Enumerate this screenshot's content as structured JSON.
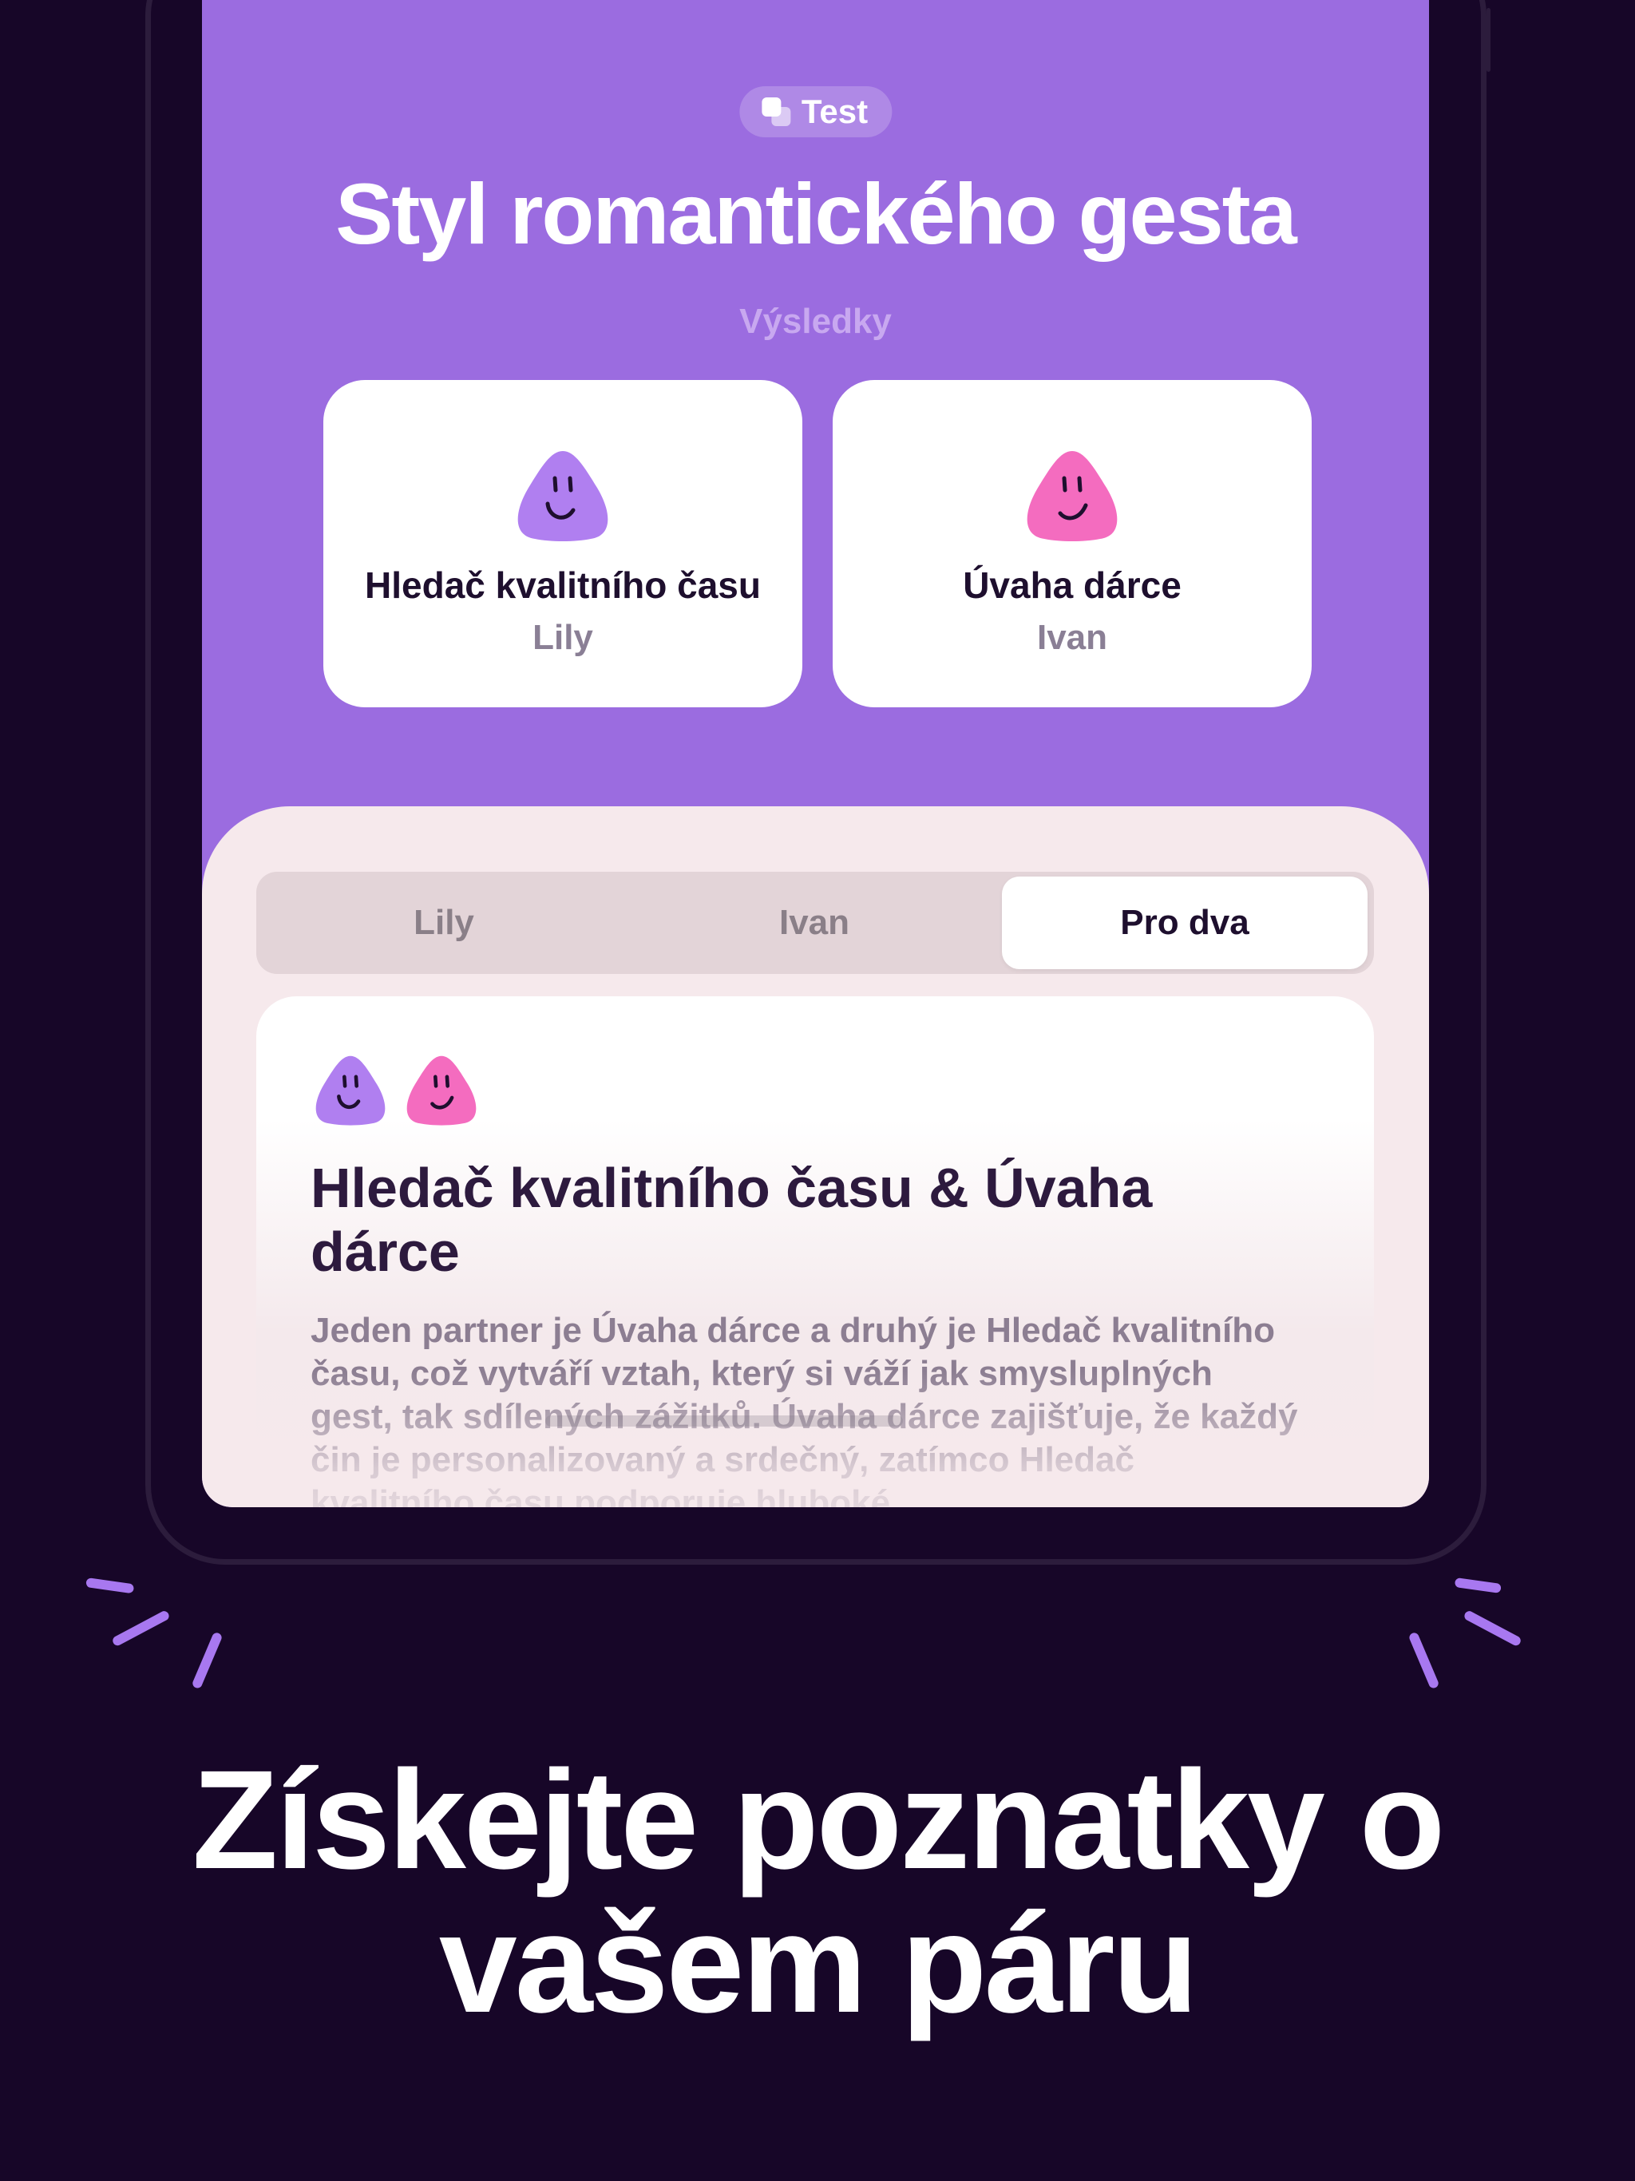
{
  "header": {
    "badge_icon": "test-icon",
    "badge_label": "Test",
    "title": "Styl romantického gesta",
    "subtitle": "Výsledky"
  },
  "results": [
    {
      "type": "Hledač kvalitního času",
      "person": "Lily",
      "face_color": "#b07ff0",
      "icon": "purple-smiley-icon"
    },
    {
      "type": "Úvaha dárce",
      "person": "Ivan",
      "face_color": "#f46cbf",
      "icon": "pink-smiley-icon"
    }
  ],
  "tabs": [
    {
      "label": "Lily",
      "active": false
    },
    {
      "label": "Ivan",
      "active": false
    },
    {
      "label": "Pro dva",
      "active": true
    }
  ],
  "couple": {
    "title": "Hledač kvalitního času & Úvaha dárce",
    "description": "Jeden partner je Úvaha dárce a druhý je Hledač kvalitního času, což vytváří vztah, který si váží jak smysluplných gest, tak sdílených zážitků. Úvaha dárce zajišťuje, že každý čin je personalizovaný a srdečný, zatímco Hledač kvalitního času podporuje hluboké"
  },
  "headline": "Získejte poznatky o vašem páru",
  "colors": {
    "background": "#170628",
    "screen_purple": "#9b6ce0",
    "sheet": "#f6e9ec",
    "accent_spark": "#a878f0"
  }
}
